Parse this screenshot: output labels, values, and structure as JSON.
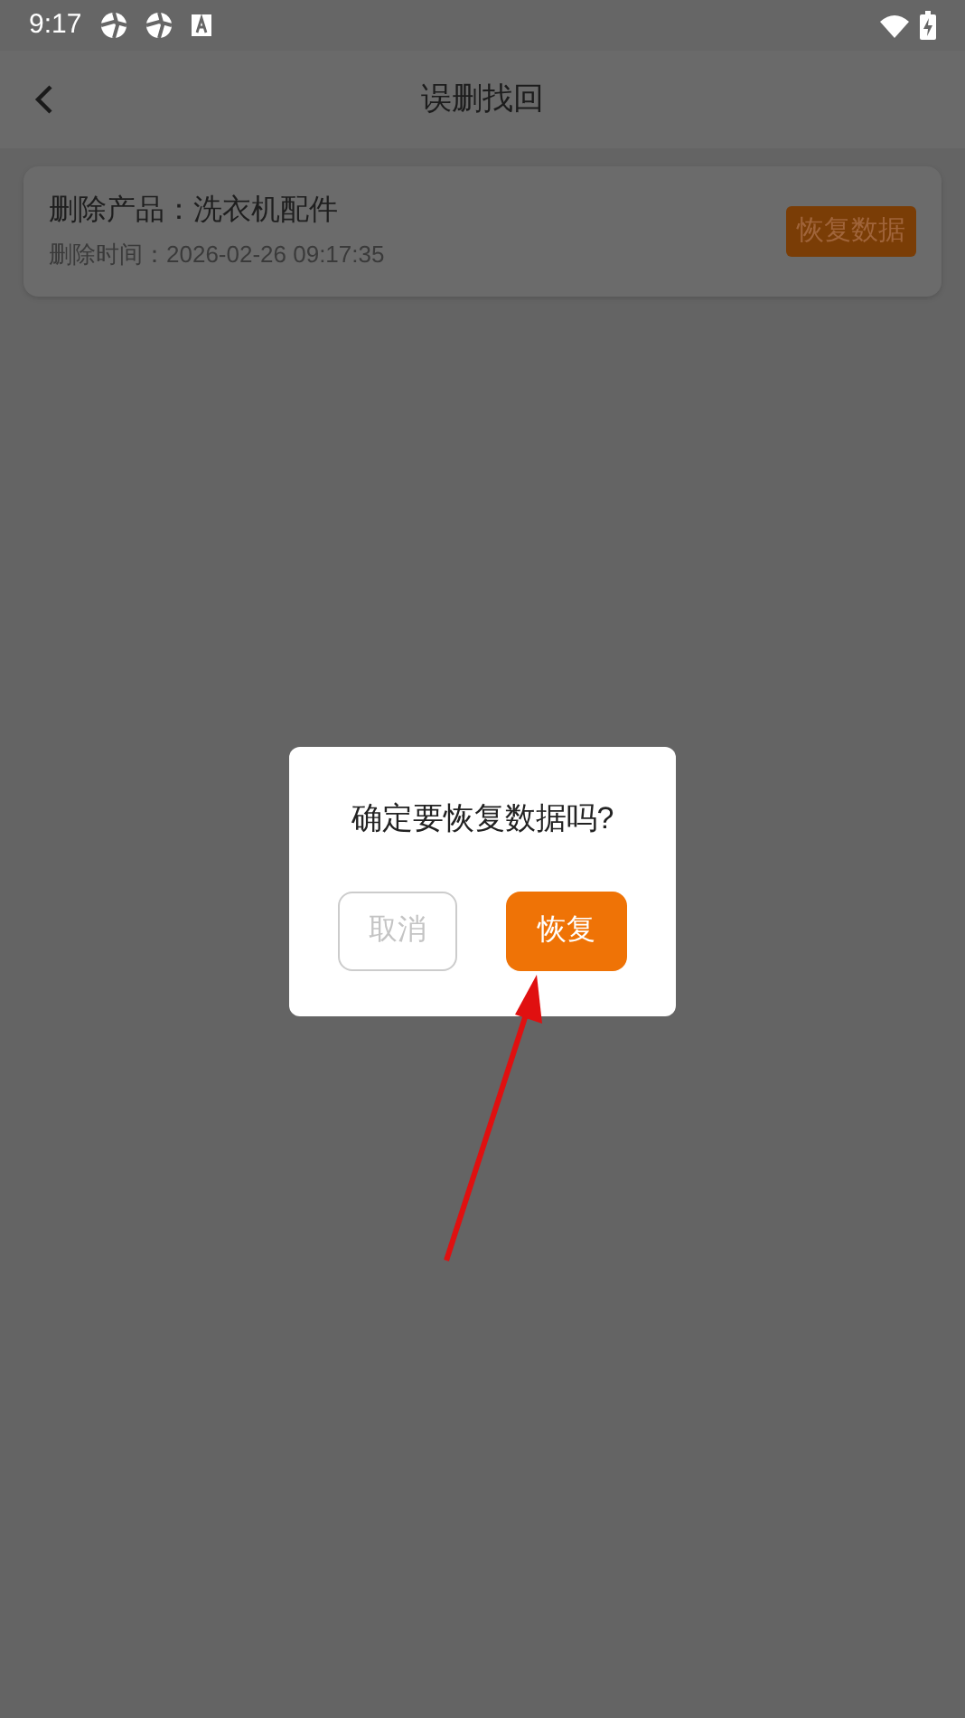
{
  "status_bar": {
    "time": "9:17"
  },
  "header": {
    "title": "误删找回"
  },
  "records": [
    {
      "product": "删除产品：洗衣机配件",
      "time": "删除时间：2026-02-26 09:17:35",
      "action": "恢复数据"
    }
  ],
  "dialog": {
    "message": "确定要恢复数据吗?",
    "buttons": [
      {
        "label": "取消",
        "kind": "cancel"
      },
      {
        "label": "恢复",
        "kind": "confirm"
      }
    ]
  }
}
